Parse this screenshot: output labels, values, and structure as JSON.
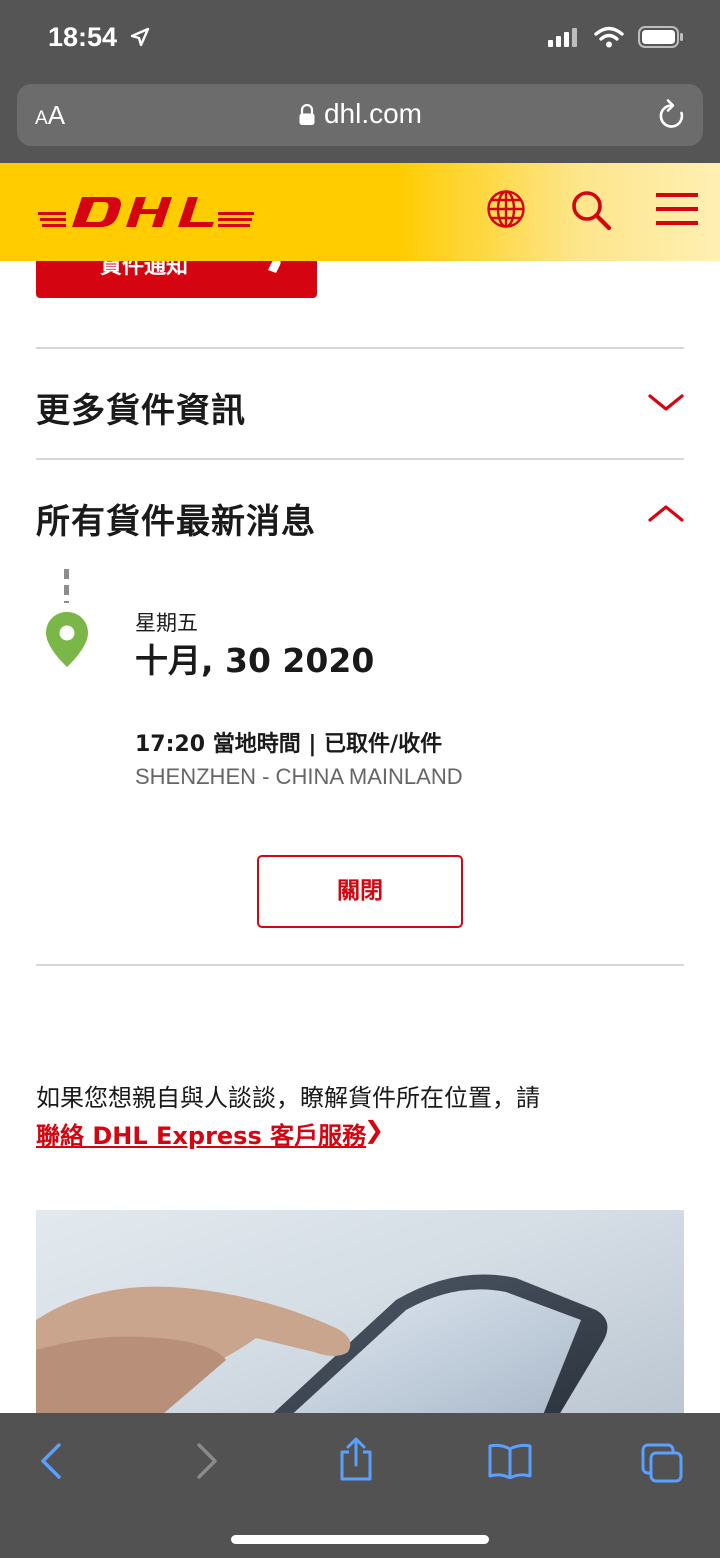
{
  "status_bar": {
    "time": "18:54"
  },
  "browser": {
    "aa_small": "A",
    "aa_big": "A",
    "url": "dhl.com"
  },
  "header": {
    "logo_text": "DHL"
  },
  "notify_button": {
    "label": "貨件通知"
  },
  "sections": {
    "more_info": {
      "title": "更多貨件資訊"
    },
    "all_updates": {
      "title": "所有貨件最新消息"
    }
  },
  "timeline": {
    "day": "星期五",
    "date": "十月, 30 2020",
    "event": "17:20 當地時間 | 已取件/收件",
    "location": "SHENZHEN - CHINA MAINLAND"
  },
  "close_button": {
    "label": "關閉"
  },
  "help": {
    "text": "如果您想親自與人談談，瞭解貨件所在位置，請",
    "link": "聯絡 DHL Express 客戶服務",
    "arrow": "❯"
  },
  "colors": {
    "dhl_red": "#d40511",
    "dhl_yellow": "#ffcc00",
    "pin_green": "#7ab648"
  }
}
